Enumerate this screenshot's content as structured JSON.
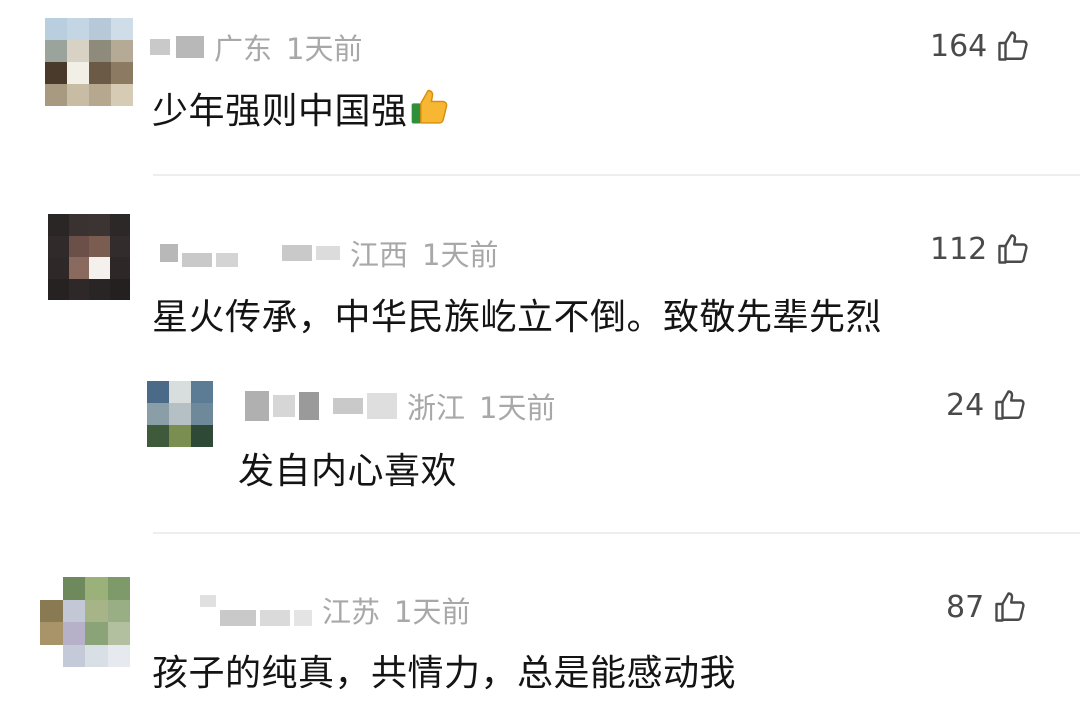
{
  "comments": [
    {
      "region": "广东",
      "time": "1天前",
      "likes": "164",
      "text": "少年强则中国强",
      "emoji": "thumbs-up"
    },
    {
      "region": "江西",
      "time": "1天前",
      "likes": "112",
      "text": "星火传承，中华民族屹立不倒。致敬先辈先烈",
      "reply": {
        "region": "浙江",
        "time": "1天前",
        "likes": "24",
        "text": "发自内心喜欢"
      }
    },
    {
      "region": "江苏",
      "time": "1天前",
      "likes": "87",
      "text": "孩子的纯真，共情力，总是能感动我"
    }
  ],
  "icons": {
    "like": "thumbs-up-outline-icon",
    "emoji": "thumbs-up-emoji-icon"
  },
  "colors": {
    "meta_gray": "#a8a8a8",
    "text": "#141414",
    "like_count": "#4a4a4a",
    "divider": "#eeeeee"
  }
}
